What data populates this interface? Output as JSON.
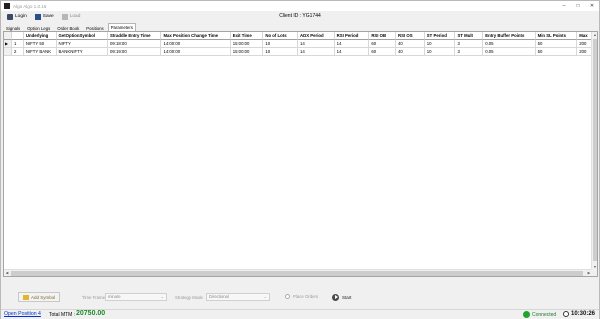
{
  "window": {
    "title": "Algo Algo 1.0.16"
  },
  "toolbar": {
    "login_label": "Login",
    "save_label": "Save",
    "load_label": "Load",
    "client_id": "Client ID : YG1744"
  },
  "tabs": [
    {
      "label": "Signals"
    },
    {
      "label": "Option Legs"
    },
    {
      "label": "Order Book"
    },
    {
      "label": "Positions"
    },
    {
      "label": "Parameters"
    }
  ],
  "grid": {
    "columns": [
      "Underlying",
      "GetOptionSymbol",
      "Straddle Entry Time",
      "Max Position Change Time",
      "Exit Time",
      "No of Lots",
      "ADX Period",
      "RSI Period",
      "RSI OB",
      "RSI OS",
      "ST Period",
      "ST Mult",
      "Entry Buffer Points",
      "Min SL Points",
      "Max"
    ],
    "rows": [
      {
        "num": "1",
        "indicator": "▶",
        "cells": [
          "NIFTY 50",
          "NIFTY",
          "09:18:00",
          "14:00:00",
          "15:00:00",
          "10",
          "14",
          "14",
          "60",
          "40",
          "10",
          "3",
          "0.05",
          "50",
          "200"
        ]
      },
      {
        "num": "2",
        "indicator": "",
        "cells": [
          "NIFTY BANK",
          "BANKNIFTY",
          "09:19:00",
          "14:00:00",
          "15:00:00",
          "10",
          "14",
          "14",
          "60",
          "40",
          "10",
          "3",
          "0.05",
          "50",
          "200"
        ]
      }
    ]
  },
  "controls": {
    "add_symbol_label": "Add Symbol",
    "time_frame_label": "Time Frame",
    "time_frame_value": "minute",
    "strategy_mode_label": "Strategy Mode",
    "strategy_mode_value": "Directional",
    "place_orders_label": "Place Orders",
    "start_label": "Start"
  },
  "status": {
    "open_positions": "Open Position 4",
    "mtm_label": "Total MTM :",
    "mtm_value": "20750.00",
    "connection": "Connected",
    "time": "10:30:26",
    "colors": {
      "mtm": "#1a8a2a",
      "connected": "#1fa52e",
      "link": "#0033cc"
    }
  }
}
